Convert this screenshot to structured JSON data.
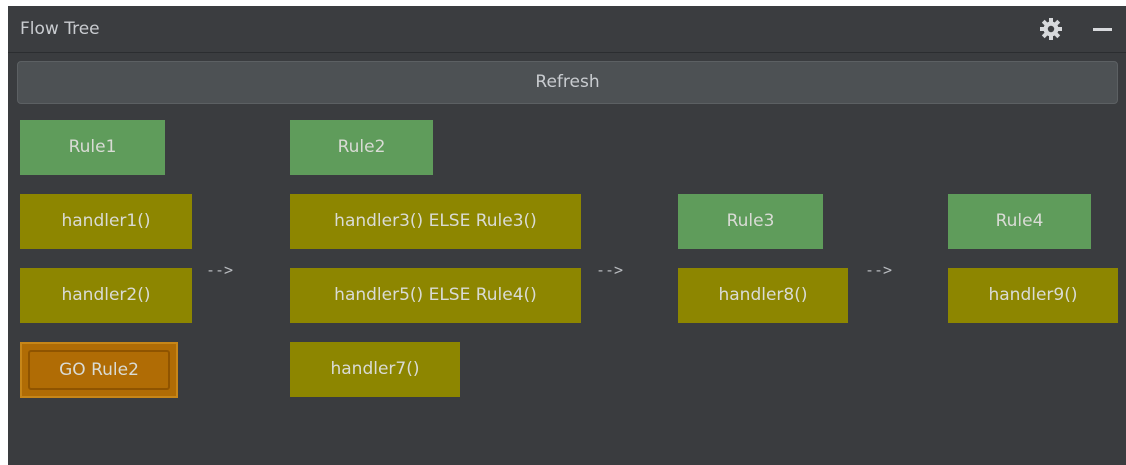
{
  "panel": {
    "title": "Flow Tree",
    "icons": {
      "settings": "gear-icon",
      "minimize": "minimize-icon"
    }
  },
  "toolbar": {
    "refresh_label": "Refresh"
  },
  "nodes": {
    "rule1": "Rule1",
    "rule2": "Rule2",
    "rule3": "Rule3",
    "rule4": "Rule4",
    "handler1": "handler1()",
    "handler2": "handler2()",
    "handler3": "handler3() ELSE Rule3()",
    "handler5": "handler5() ELSE Rule4()",
    "handler7": "handler7()",
    "handler8": "handler8()",
    "handler9": "handler9()",
    "go_rule2": "GO Rule2"
  },
  "connectors": {
    "a1": "-->",
    "a2": "-->",
    "a3": "-->"
  },
  "colors": {
    "panel_bg": "#3a3c3f",
    "rule": "#5f9c5b",
    "handler": "#8d8600",
    "go": "#b06c05"
  }
}
